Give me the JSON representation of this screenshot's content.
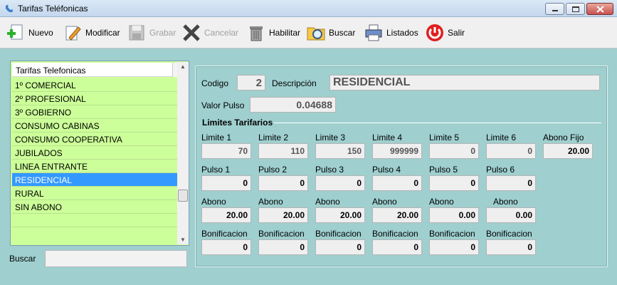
{
  "window": {
    "title": "Tarifas Teléfonicas"
  },
  "toolbar": {
    "nuevo": "Nuevo",
    "modificar": "Modificar",
    "grabar": "Grabar",
    "cancelar": "Cancelar",
    "habilitar": "Habilitar",
    "buscar": "Buscar",
    "listados": "Listados",
    "salir": "Salir"
  },
  "list": {
    "header": "Tarifas Telefonicas",
    "items": [
      "1º COMERCIAL",
      "2º PROFESIONAL",
      "3º GOBIERNO",
      "CONSUMO CABINAS",
      "CONSUMO COOPERATIVA",
      "JUBILADOS",
      "LINEA ENTRANTE",
      "RESIDENCIAL",
      "RURAL",
      "SIN ABONO"
    ],
    "selected_index": 7
  },
  "search": {
    "label": "Buscar",
    "value": ""
  },
  "form": {
    "codigo_label": "Codigo",
    "codigo": "2",
    "descripcion_label": "Descripción",
    "descripcion": "RESIDENCIAL",
    "valor_pulso_label": "Valor Pulso",
    "valor_pulso": "0.04688",
    "group_title": "Limites Tarifarios",
    "limites_labels": [
      "Limite 1",
      "Limite 2",
      "Limite 3",
      "Limite 4",
      "Limite 5",
      "Limite 6",
      "Abono Fijo"
    ],
    "limites_values": [
      "70",
      "110",
      "150",
      "999999",
      "0",
      "0",
      "20.00"
    ],
    "pulsos_labels": [
      "Pulso 1",
      "Pulso 2",
      "Pulso 3",
      "Pulso 4",
      "Pulso 5",
      "Pulso 6"
    ],
    "pulsos_values": [
      "0",
      "0",
      "0",
      "0",
      "0",
      "0"
    ],
    "abono_labels": [
      "Abono",
      "Abono",
      "Abono",
      "Abono",
      "Abono",
      "Abono"
    ],
    "abono_values": [
      "20.00",
      "20.00",
      "20.00",
      "20.00",
      "0.00",
      "0.00"
    ],
    "bonif_labels": [
      "Bonificacion",
      "Bonificacion",
      "Bonificacion",
      "Bonificacion",
      "Bonificacion",
      "Bonificacion"
    ],
    "bonif_values": [
      "0",
      "0",
      "0",
      "0",
      "0",
      "0"
    ]
  }
}
